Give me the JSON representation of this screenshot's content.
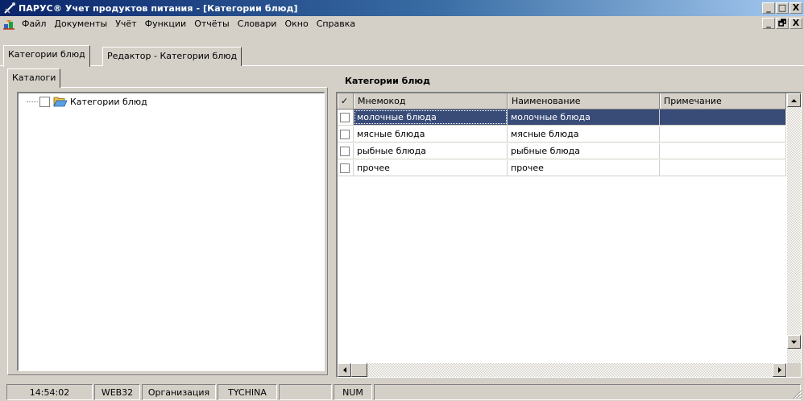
{
  "window": {
    "title": "ПАРУС® Учет продуктов питания - [Категории блюд]",
    "buttons": [
      "_",
      "□",
      "X"
    ],
    "mdi_buttons": [
      "_",
      "🗗",
      "X"
    ]
  },
  "menu": {
    "items": [
      {
        "label": "Файл"
      },
      {
        "label": "Документы"
      },
      {
        "label": "Учёт"
      },
      {
        "label": "Функции"
      },
      {
        "label": "Отчёты"
      },
      {
        "label": "Словари"
      },
      {
        "label": "Окно"
      },
      {
        "label": "Справка"
      }
    ]
  },
  "doc_tabs": [
    {
      "label": "Категории блюд",
      "active": true
    },
    {
      "label": "Редактор - Категории блюд",
      "active": false
    }
  ],
  "left_panel": {
    "tab_label": "Каталоги",
    "tree": [
      {
        "label": "Категории блюд",
        "icon": "folder-open-icon"
      }
    ]
  },
  "right_panel": {
    "title": "Категории блюд",
    "columns": [
      "✓",
      "Мнемокод",
      "Наименование",
      "Примечание"
    ],
    "rows": [
      {
        "mnemocode": "молочные блюда",
        "name": "молочные блюда",
        "note": "",
        "selected": true
      },
      {
        "mnemocode": "мясные блюда",
        "name": "мясные блюда",
        "note": "",
        "selected": false
      },
      {
        "mnemocode": "рыбные блюда",
        "name": "рыбные блюда",
        "note": "",
        "selected": false
      },
      {
        "mnemocode": "прочее",
        "name": "прочее",
        "note": "",
        "selected": false
      }
    ]
  },
  "statusbar": {
    "time": "14:54:02",
    "server": "WEB32",
    "org_label": "Организация",
    "user": "TYCHINA",
    "empty": "",
    "num": "NUM"
  },
  "colors": {
    "title_start": "#0a246a",
    "title_end": "#a6caf0",
    "selection": "#394c78",
    "face": "#d4d0c8"
  }
}
